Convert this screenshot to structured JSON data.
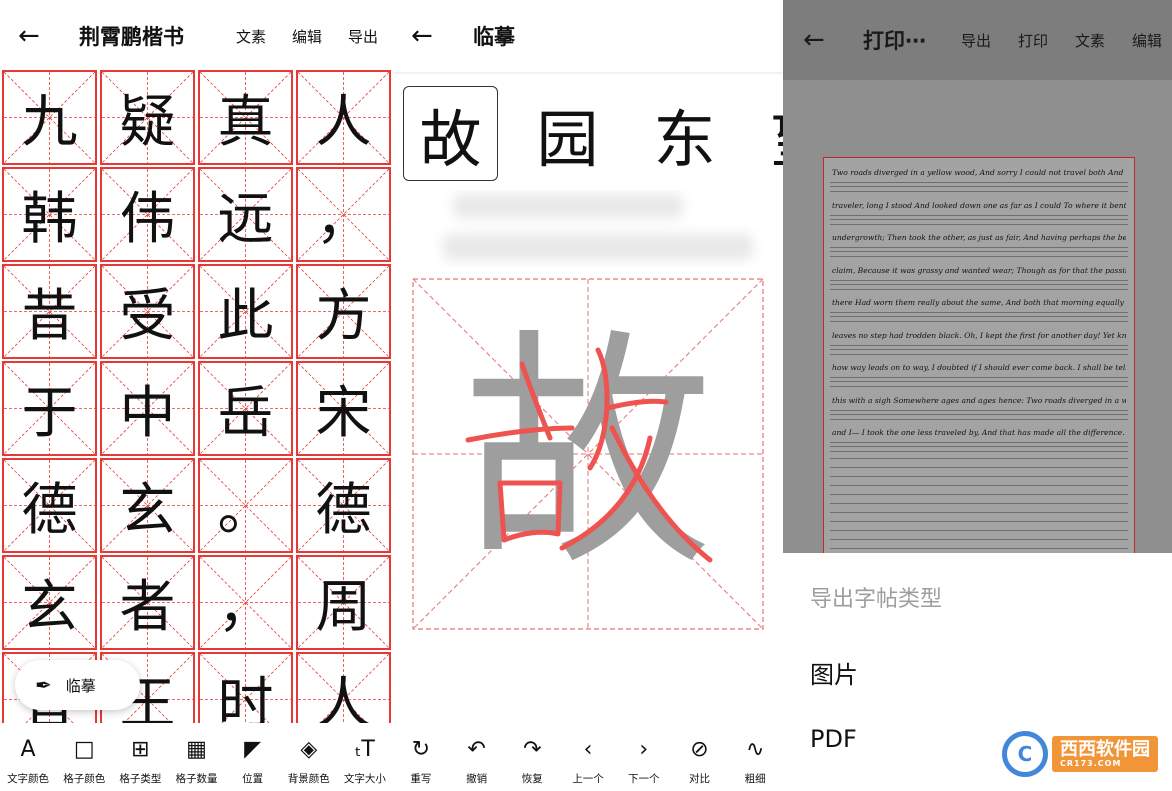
{
  "panel1": {
    "title": "荆霄鹏楷书",
    "actions": [
      "文素",
      "编辑",
      "导出"
    ],
    "grid_chars": [
      [
        "九",
        "疑",
        "真",
        "人"
      ],
      [
        "韩",
        "伟",
        "远",
        "，"
      ],
      [
        "昔",
        "受",
        "此",
        "方"
      ],
      [
        "于",
        "中",
        "岳",
        "宋"
      ],
      [
        "德",
        "玄",
        "。",
        "德"
      ],
      [
        "玄",
        "者",
        "，",
        "周"
      ],
      [
        "昔",
        "王",
        "时",
        "人"
      ]
    ],
    "fab_label": "临摹",
    "toolbar": [
      {
        "icon": "text-color-icon",
        "glyph": "A",
        "label": "文字颜色"
      },
      {
        "icon": "grid-color-icon",
        "glyph": "□",
        "label": "格子颜色"
      },
      {
        "icon": "grid-type-icon",
        "glyph": "⊞",
        "label": "格子类型"
      },
      {
        "icon": "grid-count-icon",
        "glyph": "▦",
        "label": "格子数量"
      },
      {
        "icon": "position-icon",
        "glyph": "◤",
        "label": "位置"
      },
      {
        "icon": "background-color-icon",
        "glyph": "◈",
        "label": "背景颜色"
      },
      {
        "icon": "text-size-icon",
        "glyph": "ₜT",
        "label": "文字大小"
      }
    ],
    "accent": "#e53935"
  },
  "panel2": {
    "title": "临摹",
    "strip_chars": [
      "故",
      "园",
      "东",
      "望"
    ],
    "big_char": "故",
    "toolbar": [
      {
        "icon": "rewrite-icon",
        "glyph": "↻",
        "label": "重写"
      },
      {
        "icon": "undo-icon",
        "glyph": "↶",
        "label": "撤销"
      },
      {
        "icon": "redo-icon",
        "glyph": "↷",
        "label": "恢复"
      },
      {
        "icon": "previous-icon",
        "glyph": "‹",
        "label": "上一个"
      },
      {
        "icon": "next-icon",
        "glyph": "›",
        "label": "下一个"
      },
      {
        "icon": "compare-icon",
        "glyph": "⊘",
        "label": "对比"
      },
      {
        "icon": "thickness-icon",
        "glyph": "∿",
        "label": "粗细"
      }
    ]
  },
  "panel3": {
    "title": "打印⋯",
    "actions": [
      "导出",
      "打印",
      "文素",
      "编辑"
    ],
    "sheet_lines": [
      "Two roads diverged in a yellow wood, And sorry I could not travel both And be one",
      "traveler, long I stood And looked down one as far as I could To where it bent in the",
      "undergrowth; Then took the other, as just as fair, And having perhaps the better",
      "claim, Because it was grassy and wanted wear; Though as for that the passing",
      "there Had worn them really about the same, And both that morning equally lay In",
      "leaves no step had trodden black. Oh, I kept the first for another day! Yet knowing",
      "how way leads on to way, I doubted if I should ever come back. I shall be telling",
      "this with a sigh Somewhere ages and ages hence: Two roads diverged in a wood,",
      "and I— I took the one less traveled by, And that has made all the difference."
    ],
    "menu_heading": "导出字帖类型",
    "menu_items": [
      "图片",
      "PDF"
    ],
    "watermark": {
      "main": "西西软件园",
      "sub": "CR173.COM"
    }
  }
}
